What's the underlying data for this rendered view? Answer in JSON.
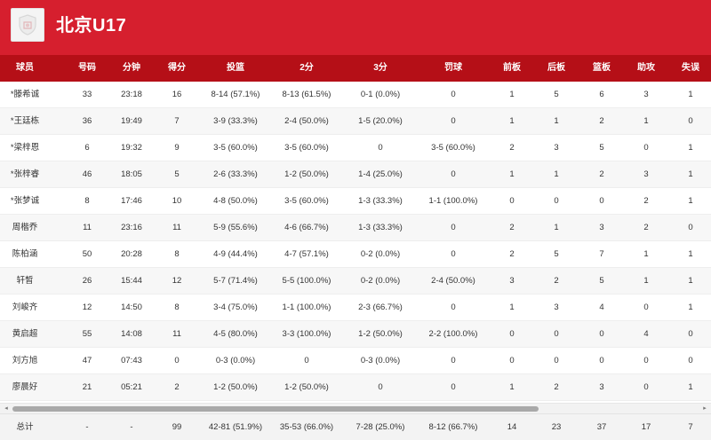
{
  "team": {
    "name": "北京U17",
    "logo_icon": "team-logo-icon"
  },
  "colors": {
    "header": "#d61f2e",
    "table_header": "#b50f17"
  },
  "columns": [
    "球员",
    "号码",
    "分钟",
    "得分",
    "投篮",
    "2分",
    "3分",
    "罚球",
    "前板",
    "后板",
    "篮板",
    "助攻",
    "失误"
  ],
  "players": [
    [
      "*滕希诚",
      "33",
      "23:18",
      "16",
      "8-14 (57.1%)",
      "8-13 (61.5%)",
      "0-1 (0.0%)",
      "0",
      "1",
      "5",
      "6",
      "3",
      "1"
    ],
    [
      "*王廷栋",
      "36",
      "19:49",
      "7",
      "3-9 (33.3%)",
      "2-4 (50.0%)",
      "1-5 (20.0%)",
      "0",
      "1",
      "1",
      "2",
      "1",
      "0"
    ],
    [
      "*梁梓恩",
      "6",
      "19:32",
      "9",
      "3-5 (60.0%)",
      "3-5 (60.0%)",
      "0",
      "3-5 (60.0%)",
      "2",
      "3",
      "5",
      "0",
      "1"
    ],
    [
      "*张梓睿",
      "46",
      "18:05",
      "5",
      "2-6 (33.3%)",
      "1-2 (50.0%)",
      "1-4 (25.0%)",
      "0",
      "1",
      "1",
      "2",
      "3",
      "1"
    ],
    [
      "*张梦诚",
      "8",
      "17:46",
      "10",
      "4-8 (50.0%)",
      "3-5 (60.0%)",
      "1-3 (33.3%)",
      "1-1 (100.0%)",
      "0",
      "0",
      "0",
      "2",
      "1"
    ],
    [
      "周楷乔",
      "11",
      "23:16",
      "11",
      "5-9 (55.6%)",
      "4-6 (66.7%)",
      "1-3 (33.3%)",
      "0",
      "2",
      "1",
      "3",
      "2",
      "0"
    ],
    [
      "陈柏涵",
      "50",
      "20:28",
      "8",
      "4-9 (44.4%)",
      "4-7 (57.1%)",
      "0-2 (0.0%)",
      "0",
      "2",
      "5",
      "7",
      "1",
      "1"
    ],
    [
      "轩皙",
      "26",
      "15:44",
      "12",
      "5-7 (71.4%)",
      "5-5 (100.0%)",
      "0-2 (0.0%)",
      "2-4 (50.0%)",
      "3",
      "2",
      "5",
      "1",
      "1"
    ],
    [
      "刘峻齐",
      "12",
      "14:50",
      "8",
      "3-4 (75.0%)",
      "1-1 (100.0%)",
      "2-3 (66.7%)",
      "0",
      "1",
      "3",
      "4",
      "0",
      "1"
    ],
    [
      "黄启超",
      "55",
      "14:08",
      "11",
      "4-5 (80.0%)",
      "3-3 (100.0%)",
      "1-2 (50.0%)",
      "2-2 (100.0%)",
      "0",
      "0",
      "0",
      "4",
      "0"
    ],
    [
      "刘方旭",
      "47",
      "07:43",
      "0",
      "0-3 (0.0%)",
      "0",
      "0-3 (0.0%)",
      "0",
      "0",
      "0",
      "0",
      "0",
      "0"
    ],
    [
      "廖晨好",
      "21",
      "05:21",
      "2",
      "1-2 (50.0%)",
      "1-2 (50.0%)",
      "0",
      "0",
      "1",
      "2",
      "3",
      "0",
      "1"
    ]
  ],
  "totals": [
    "总计",
    "-",
    "-",
    "99",
    "42-81 (51.9%)",
    "35-53 (66.0%)",
    "7-28 (25.0%)",
    "8-12 (66.7%)",
    "14",
    "23",
    "37",
    "17",
    "7"
  ],
  "scrollbar": {
    "left_arrow": "◂",
    "right_arrow": "▸"
  }
}
